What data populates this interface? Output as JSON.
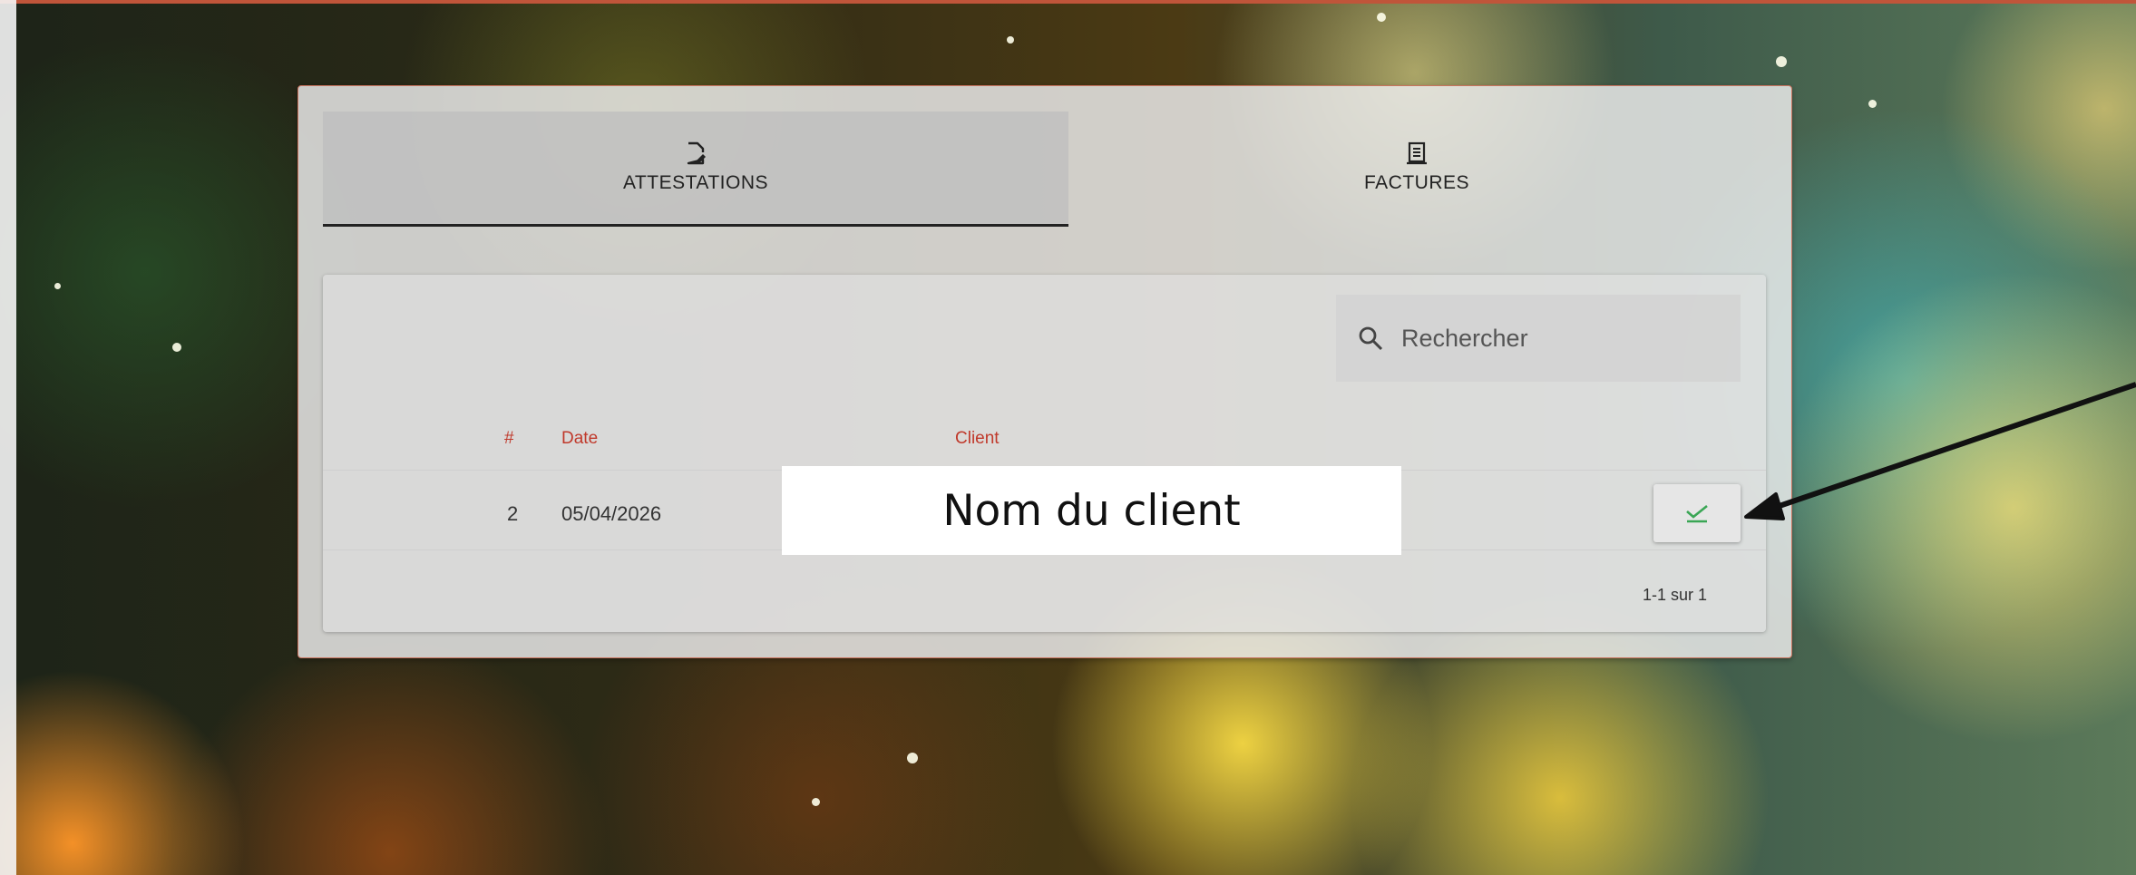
{
  "colors": {
    "accent": "#c0392b",
    "check": "#3aa655",
    "panel_border": "#c9735e"
  },
  "tabs": [
    {
      "label": "ATTESTATIONS",
      "icon": "file-edit-icon",
      "active": true
    },
    {
      "label": "FACTURES",
      "icon": "receipt-icon",
      "active": false
    }
  ],
  "search": {
    "placeholder": "Rechercher",
    "icon": "search-icon"
  },
  "table": {
    "columns": [
      "#",
      "Date",
      "Client"
    ],
    "rows": [
      {
        "num": "2",
        "date": "05/04/2026",
        "client": "Nom du client",
        "action_icon": "check-icon"
      }
    ],
    "pagination": "1-1 sur 1"
  }
}
